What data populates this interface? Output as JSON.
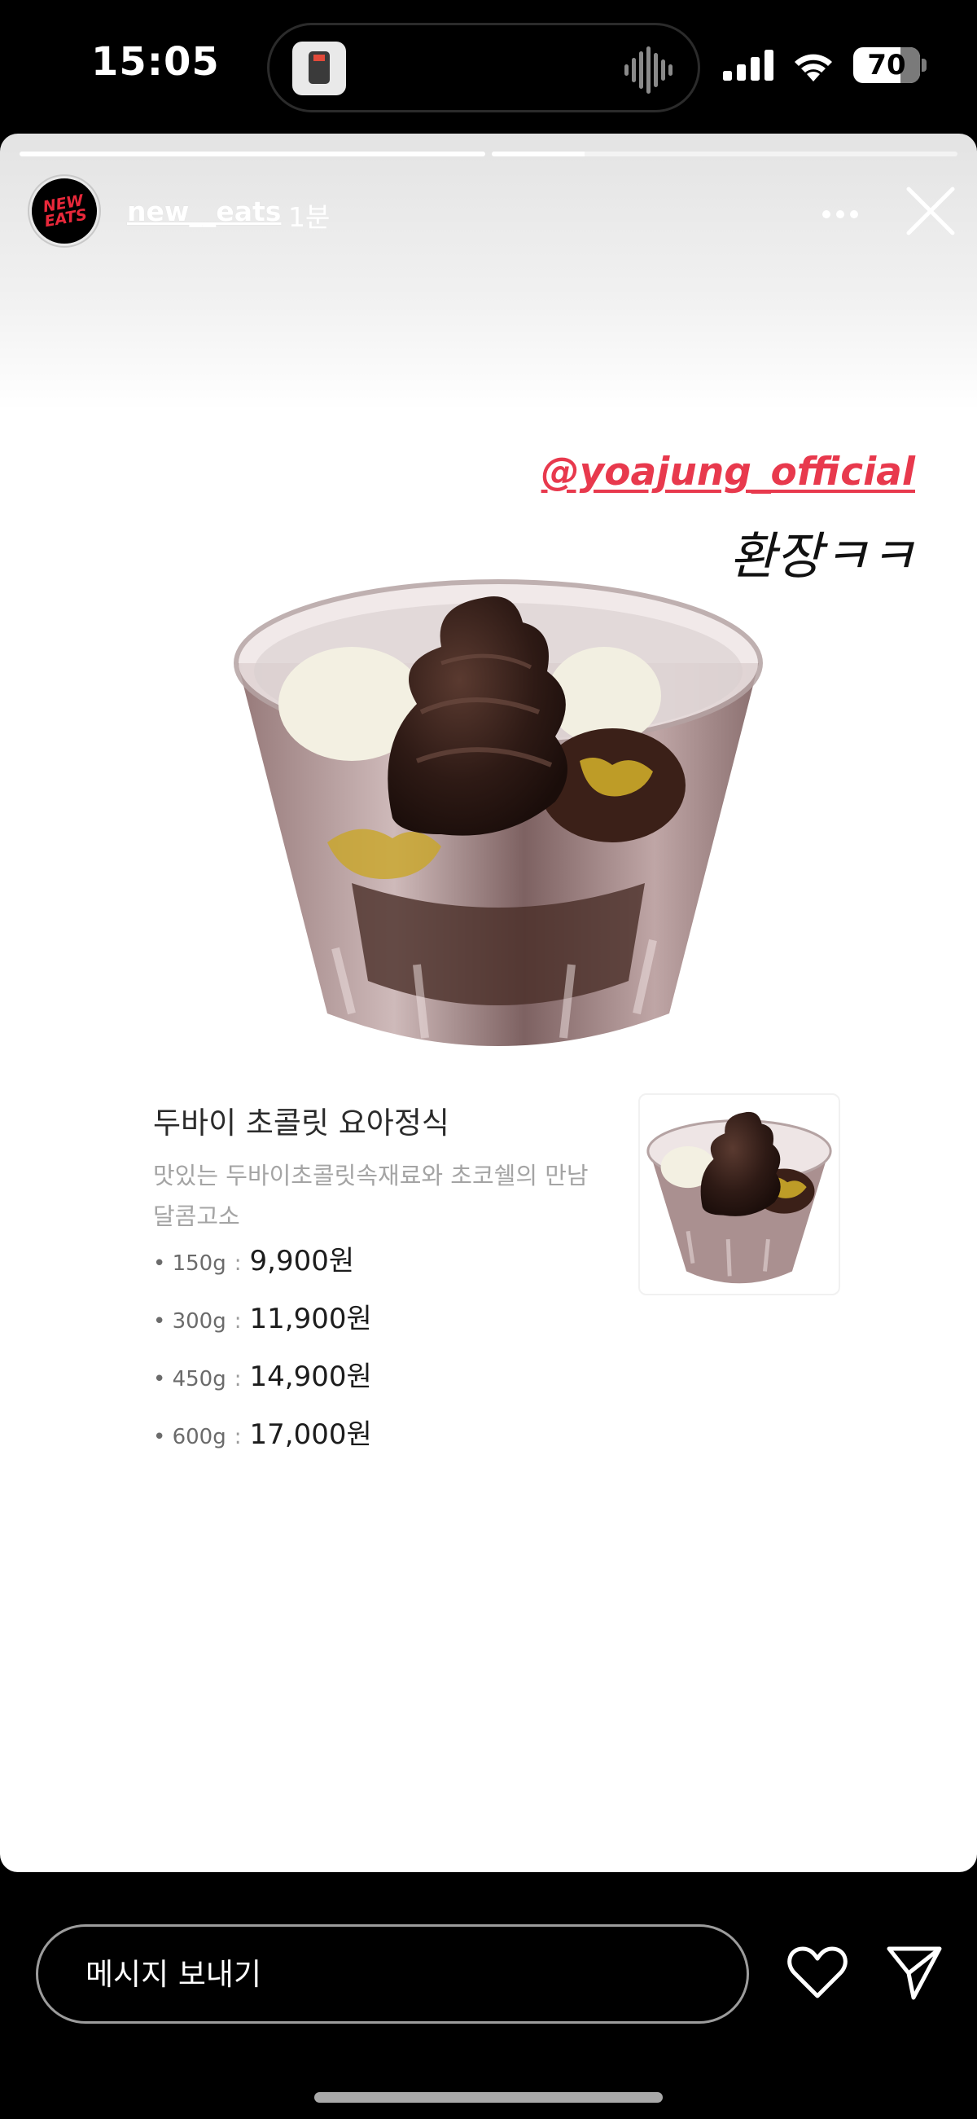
{
  "status_bar": {
    "time": "15:05",
    "battery": "70",
    "icons": [
      "signal-icon",
      "wifi-icon",
      "battery-icon"
    ]
  },
  "dynamic_island": {
    "activity": "now-playing",
    "icons": [
      "album-thumbnail-icon",
      "audio-wave-icon"
    ]
  },
  "story": {
    "progress": [
      1.0,
      0.2
    ],
    "account": {
      "username": "new__eats",
      "time_ago": "1분",
      "avatar_logo": "NEW EATS"
    },
    "mention": "@yoajung_official",
    "sticker_text": "환장ㅋㅋ",
    "menu": {
      "title": "두바이 초콜릿 요아정식",
      "description": "맛있는 두바이초콜릿속재료와 초코쉘의 만남 달콤고소",
      "separator": ":",
      "prices": [
        {
          "size": "• 150g",
          "price": "9,900원"
        },
        {
          "size": "• 300g",
          "price": "11,900원"
        },
        {
          "size": "• 450g",
          "price": "14,900원"
        },
        {
          "size": "• 600g",
          "price": "17,000원"
        }
      ]
    }
  },
  "bottom_bar": {
    "message_placeholder": "메시지 보내기",
    "icons": [
      "heart-icon",
      "send-icon"
    ]
  },
  "colors": {
    "mention": "#e8394d",
    "background": "#000000",
    "card": "#ffffff"
  }
}
